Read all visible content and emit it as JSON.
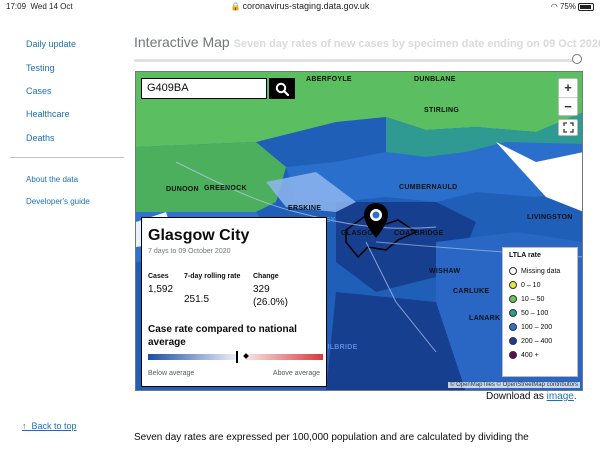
{
  "status_bar": {
    "time": "17:09",
    "date": "Wed 14 Oct",
    "url": "coronavirus-staging.data.gov.uk",
    "battery": "75%"
  },
  "sidebar": {
    "items": [
      "Daily update",
      "Testing",
      "Cases",
      "Healthcare",
      "Deaths"
    ],
    "secondary": [
      "About the data",
      "Developer's guide"
    ],
    "back_to_top": "Back to top"
  },
  "section": {
    "title": "Interactive Map",
    "subtitle_faded": "Seven day rates of new cases by specimen date ending on",
    "subtitle_date": "09 Oct 2020"
  },
  "search": {
    "value": "G409BA"
  },
  "map": {
    "places": [
      "ABERFOYLE",
      "DUNBLANE",
      "STIRLING",
      "DUNOON",
      "GREENOCK",
      "CUMBERNAULD",
      "ERSKINE",
      "GLASGOW",
      "COATBRIDGE",
      "LIVINGSTON",
      "WISHAW",
      "CARLUKE",
      "LANARK",
      "PAISLEY",
      "EAST KILBRIDE"
    ],
    "attribution": "© OpenMapTiles © OpenStreetMap contributors",
    "zoom_in": "+",
    "zoom_out": "−"
  },
  "card": {
    "city": "Glasgow City",
    "period": "7 days to 09 October 2020",
    "cases_label": "Cases",
    "cases_value": "1,592",
    "rate_label": "7-day rolling rate",
    "rate_value": "251.5",
    "change_label": "Change",
    "change_value": "329",
    "change_pct": "(26.0%)",
    "compare_title": "Case rate compared to national average",
    "compare_position": 0.5,
    "below": "Below average",
    "above": "Above average"
  },
  "legend": {
    "title": "LTLA rate",
    "items": [
      {
        "label": "Missing data",
        "color": "#ffffff"
      },
      {
        "label": "0 – 10",
        "color": "#e7e449"
      },
      {
        "label": "10 – 50",
        "color": "#6cc35f"
      },
      {
        "label": "50 – 100",
        "color": "#2f9c8f"
      },
      {
        "label": "100 – 200",
        "color": "#2f6fc9"
      },
      {
        "label": "200 – 400",
        "color": "#1a3f92"
      },
      {
        "label": "400 +",
        "color": "#5b0a54"
      }
    ]
  },
  "download": {
    "prefix": "Download as",
    "link": "image",
    "suffix": "."
  },
  "footnote": "Seven day rates are expressed per 100,000 population and are calculated by dividing the"
}
